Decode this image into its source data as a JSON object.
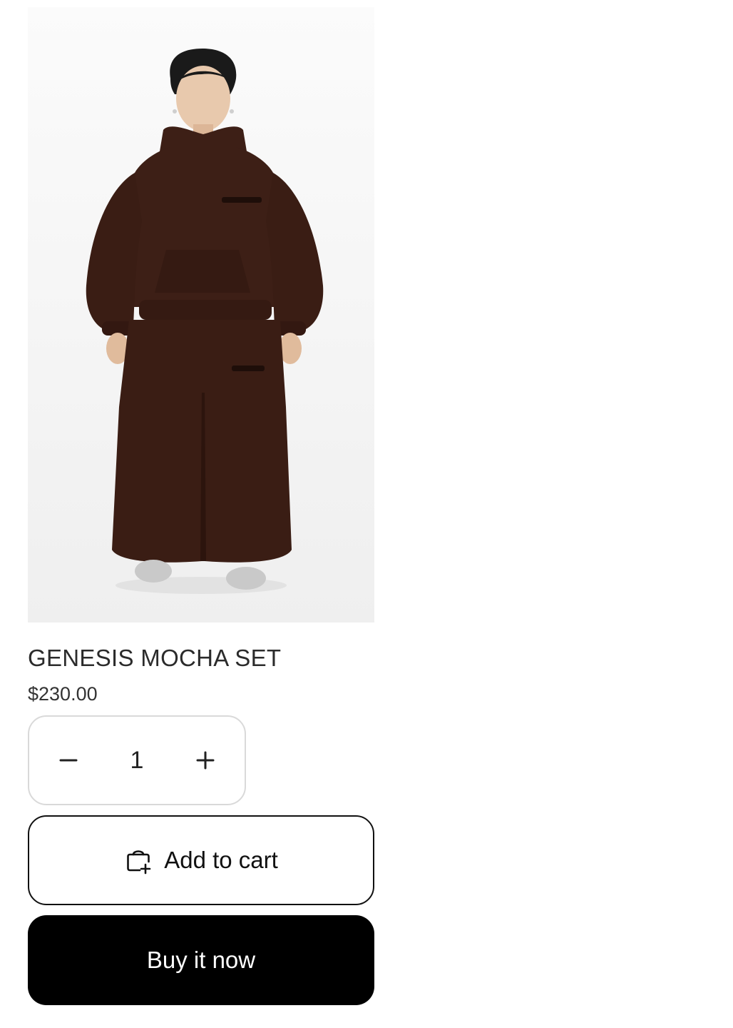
{
  "product": {
    "image_alt": "Model wearing brown hoodie and wide-leg sweatpants",
    "title": "GENESIS MOCHA SET",
    "price": "$230.00"
  },
  "quantity": {
    "value": "1",
    "decrease_icon": "minus-icon",
    "increase_icon": "plus-icon"
  },
  "actions": {
    "add_to_cart_label": "Add to cart",
    "add_to_cart_icon": "bag-plus-icon",
    "buy_now_label": "Buy it now"
  },
  "colors": {
    "garment": "#3d1f16",
    "buy_now_bg": "#000000",
    "border_light": "#d9d9d9"
  }
}
